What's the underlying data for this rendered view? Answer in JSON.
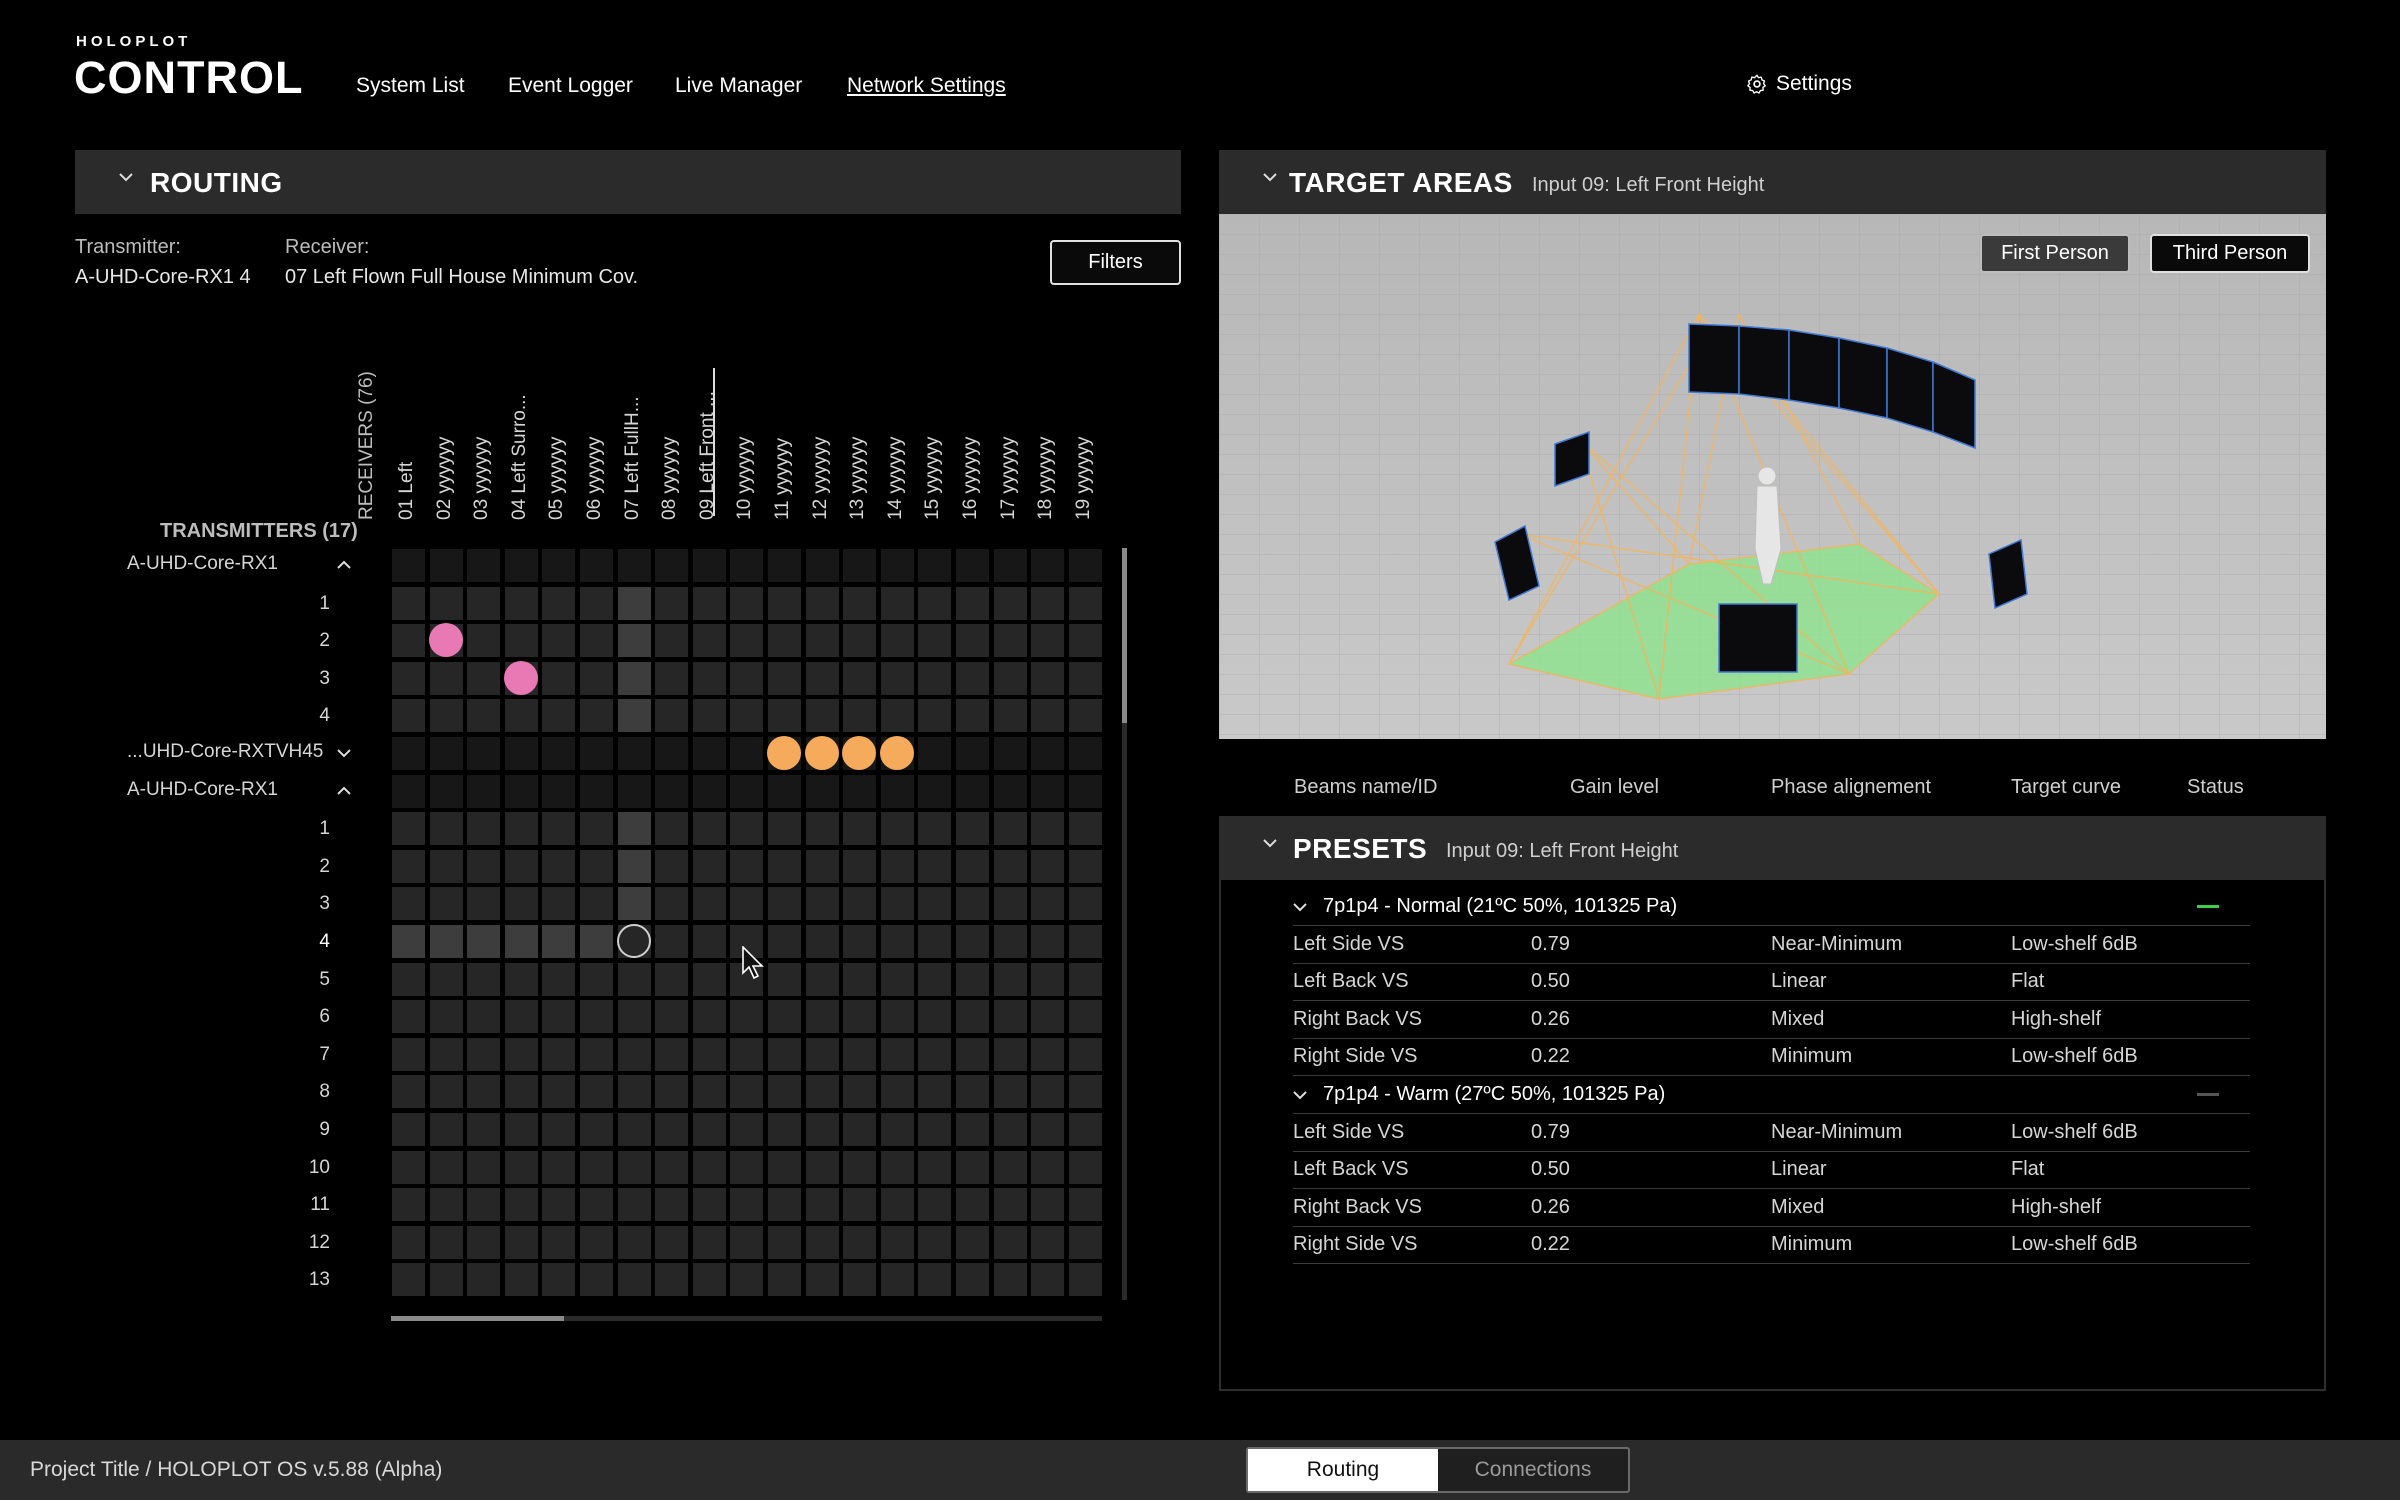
{
  "header": {
    "brand_small": "HOLOPLOT",
    "brand_big": "CONTROL",
    "nav": [
      "System List",
      "Event Logger",
      "Live Manager",
      "Network Settings"
    ],
    "settings_label": "Settings"
  },
  "routing": {
    "title": "ROUTING",
    "transmitter_label": "Transmitter:",
    "transmitter_value": "A-UHD-Core-RX1 4",
    "receiver_label": "Receiver:",
    "receiver_value": "07 Left Flown Full House Minimum Cov.",
    "filters_label": "Filters",
    "receivers_header": "RECEIVERS (76)",
    "transmitters_header": "TRANSMITTERS (17)",
    "columns": [
      "01 Left",
      "02 yyyyyy",
      "03 yyyyyy",
      "04 Left Surro...",
      "05 yyyyyy",
      "06 yyyyyy",
      "07 Left FullH...",
      "08 yyyyyy",
      "09 Left Front ...",
      "10 yyyyyy",
      "11 yyyyyy",
      "12 yyyyyy",
      "13 yyyyyy",
      "14 yyyyyy",
      "15 yyyyyy",
      "16 yyyyyy",
      "17 yyyyyy",
      "18 yyyyyy",
      "19 yyyyyy"
    ],
    "rows": [
      {
        "label": "A-UHD-Core-RX1",
        "group": true,
        "expanded": true
      },
      {
        "label": "1"
      },
      {
        "label": "2"
      },
      {
        "label": "3"
      },
      {
        "label": "4"
      },
      {
        "label": "...UHD-Core-RXTVH45",
        "group": true,
        "expanded": false
      },
      {
        "label": "A-UHD-Core-RX1",
        "group": true,
        "expanded": true
      },
      {
        "label": "1"
      },
      {
        "label": "2"
      },
      {
        "label": "3"
      },
      {
        "label": "4",
        "selected": true
      },
      {
        "label": "5"
      },
      {
        "label": "6"
      },
      {
        "label": "7"
      },
      {
        "label": "8"
      },
      {
        "label": "9"
      },
      {
        "label": "10"
      },
      {
        "label": "11"
      },
      {
        "label": "12"
      },
      {
        "label": "13"
      }
    ],
    "routes": [
      {
        "row": 2,
        "col": 1,
        "color": "#e879b4"
      },
      {
        "row": 3,
        "col": 3,
        "color": "#e879b4"
      },
      {
        "row": 5,
        "col": 10,
        "color": "#f5ab5b"
      },
      {
        "row": 5,
        "col": 11,
        "color": "#f5ab5b"
      },
      {
        "row": 5,
        "col": 12,
        "color": "#f5ab5b"
      },
      {
        "row": 5,
        "col": 13,
        "color": "#f5ab5b"
      }
    ],
    "crosshair": {
      "row": 10,
      "col": 6
    },
    "horizontal_scroll_fraction": 0.25
  },
  "target_areas": {
    "title": "TARGET AREAS",
    "subtitle": "Input 09: Left Front Height",
    "view_buttons": [
      "First Person",
      "Third Person"
    ],
    "active_view": "Third Person",
    "columns": [
      "Beams name/ID",
      "Gain level",
      "Phase alignement",
      "Target curve",
      "Status"
    ]
  },
  "presets": {
    "title": "PRESETS",
    "subtitle": "Input 09: Left Front Height",
    "groups": [
      {
        "name": "7p1p4 - Normal (21ºC 50%, 101325 Pa)",
        "status_color": "#3ecf4a",
        "rows": [
          {
            "beam": "Left Side VS",
            "gain": "0.79",
            "phase": "Near-Minimum",
            "curve": "Low-shelf 6dB"
          },
          {
            "beam": "Left Back VS",
            "gain": "0.50",
            "phase": "Linear",
            "curve": "Flat"
          },
          {
            "beam": "Right Back VS",
            "gain": "0.26",
            "phase": "Mixed",
            "curve": "High-shelf"
          },
          {
            "beam": "Right Side VS",
            "gain": "0.22",
            "phase": "Minimum",
            "curve": "Low-shelf 6dB"
          }
        ]
      },
      {
        "name": "7p1p4 - Warm (27ºC 50%, 101325 Pa)",
        "status_color": "#555555",
        "rows": [
          {
            "beam": "Left Side VS",
            "gain": "0.79",
            "phase": "Near-Minimum",
            "curve": "Low-shelf 6dB"
          },
          {
            "beam": "Left Back VS",
            "gain": "0.50",
            "phase": "Linear",
            "curve": "Flat"
          },
          {
            "beam": "Right Back VS",
            "gain": "0.26",
            "phase": "Mixed",
            "curve": "High-shelf"
          },
          {
            "beam": "Right Side VS",
            "gain": "0.22",
            "phase": "Minimum",
            "curve": "Low-shelf 6dB"
          }
        ]
      }
    ]
  },
  "footer": {
    "project_title": "Project Title / HOLOPLOT OS v.5.88 (Alpha)",
    "tabs": [
      "Routing",
      "Connections"
    ],
    "active_tab": "Routing"
  }
}
